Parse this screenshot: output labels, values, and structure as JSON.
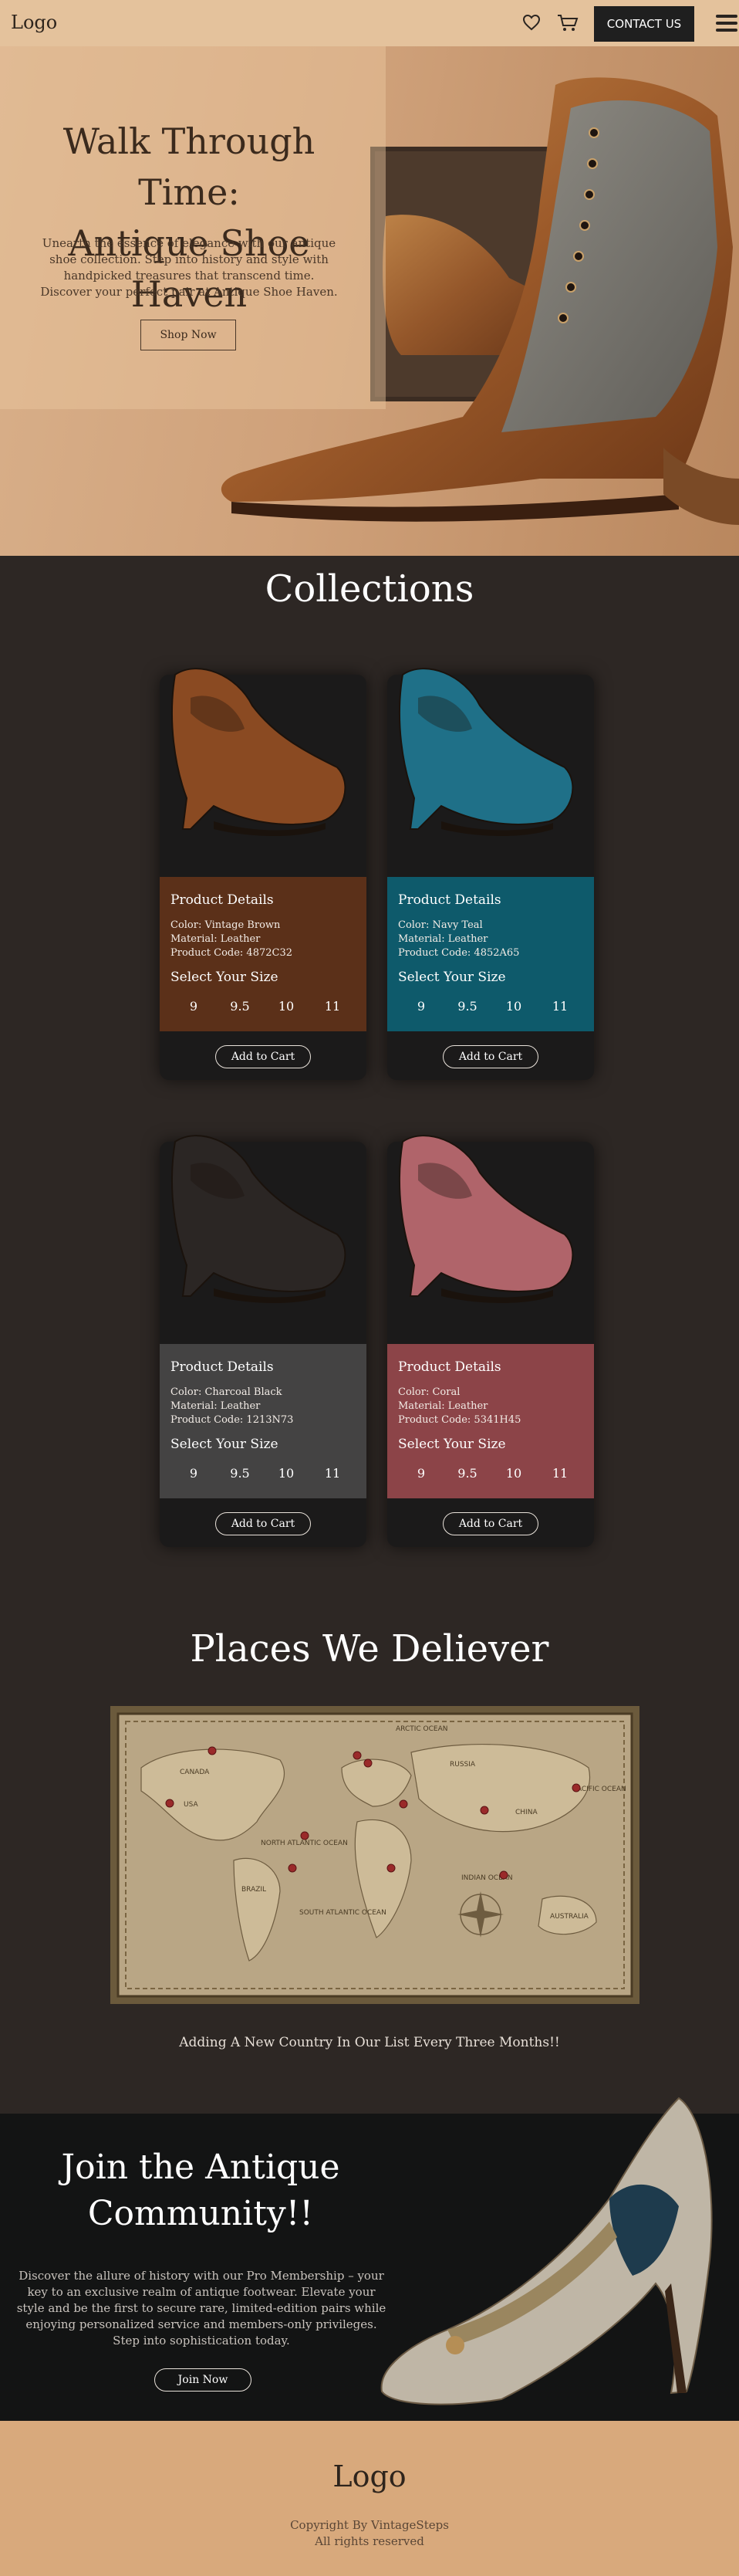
{
  "nav": {
    "logo": "Logo",
    "contact_label": "CONTACT US",
    "icons": [
      "heart-icon",
      "cart-icon",
      "menu-icon"
    ]
  },
  "hero": {
    "title_line1": "Walk Through Time:",
    "title_line2": "Antique Shoe Haven",
    "description": "Unearth the essence of elegance with our antique shoe collection. Step into history and style with handpicked treasures that transcend time. Discover your perfect pair at Antique Shoe Haven.",
    "button_label": "Shop Now"
  },
  "collections": {
    "title": "Collections",
    "details_heading": "Product Details",
    "size_heading": "Select Your Size",
    "sizes": [
      "9",
      "9.5",
      "10",
      "11"
    ],
    "button_label": "Add to Cart",
    "products": [
      {
        "color": "Color: Vintage Brown",
        "material": "Material: Leather",
        "code": "Product Code: 4872C32",
        "panel_color": "#5b3019"
      },
      {
        "color": "Color: Navy Teal",
        "material": "Material: Leather",
        "code": "Product Code: 4852A65",
        "panel_color": "#0e5a6b"
      },
      {
        "color": "Color: Charcoal Black",
        "material": "Material: Leather",
        "code": "Product Code: 1213N73",
        "panel_color": "#444343"
      },
      {
        "color": "Color: Coral",
        "material": "Material: Leather",
        "code": "Product Code: 5341H45",
        "panel_color": "#8c4448"
      }
    ]
  },
  "places": {
    "title": "Places We Deliever",
    "note": "Adding A New Country In Our List Every Three Months!!",
    "map_labels": [
      "ARCTIC OCEAN",
      "CANADA",
      "USA",
      "RUSSIA",
      "CHINA",
      "PACIFIC OCEAN",
      "NORTH ATLANTIC OCEAN",
      "BRAZIL",
      "SOUTH ATLANTIC OCEAN",
      "INDIAN OCEAN",
      "AUSTRALIA"
    ]
  },
  "community": {
    "title_line1": "Join the Antique",
    "title_line2": "Community!!",
    "description": "Discover the allure of history with our Pro Membership – your key to an exclusive realm of antique footwear. Elevate your style and be the first to secure rare, limited-edition pairs while enjoying personalized service and members-only privileges. Step into sophistication today.",
    "button_label": "Join Now"
  },
  "footer": {
    "logo": "Logo",
    "copyright": "Copyright By VintageSteps",
    "rights": "All rights reserved"
  },
  "colors": {
    "nav_bg": "#e4c29c",
    "page_bg": "#2d2724",
    "community_bg": "#131414",
    "footer_bg": "#d8a97c"
  }
}
